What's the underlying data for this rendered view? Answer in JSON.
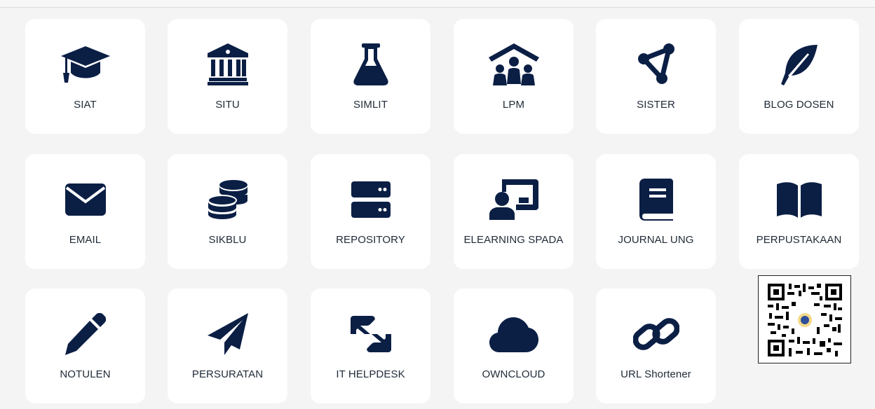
{
  "colors": {
    "icon": "#0b1f45",
    "tile_bg": "#ffffff",
    "page_bg": "#f4f4f4",
    "label": "#1f2a37"
  },
  "tiles": [
    {
      "label": "SIAT",
      "icon": "graduation-cap-icon"
    },
    {
      "label": "SITU",
      "icon": "building-columns-icon"
    },
    {
      "label": "SIMLIT",
      "icon": "flask-icon"
    },
    {
      "label": "LPM",
      "icon": "people-roof-icon"
    },
    {
      "label": "SISTER",
      "icon": "share-nodes-icon"
    },
    {
      "label": "BLOG DOSEN",
      "icon": "feather-icon"
    },
    {
      "label": "EMAIL",
      "icon": "envelope-icon"
    },
    {
      "label": "SIKBLU",
      "icon": "coins-icon"
    },
    {
      "label": "REPOSITORY",
      "icon": "server-icon"
    },
    {
      "label": "ELEARNING SPADA",
      "icon": "chalkboard-user-icon"
    },
    {
      "label": "JOURNAL UNG",
      "icon": "book-icon"
    },
    {
      "label": "PERPUSTAKAAN",
      "icon": "book-open-icon"
    },
    {
      "label": "NOTULEN",
      "icon": "pencil-icon"
    },
    {
      "label": "PERSURATAN",
      "icon": "paper-plane-icon"
    },
    {
      "label": "IT HELPDESK",
      "icon": "handshake-icon"
    },
    {
      "label": "OWNCLOUD",
      "icon": "cloud-icon"
    },
    {
      "label": "URL Shortener",
      "icon": "link-icon"
    }
  ],
  "qr_code": {
    "icon": "qr-code-icon"
  }
}
